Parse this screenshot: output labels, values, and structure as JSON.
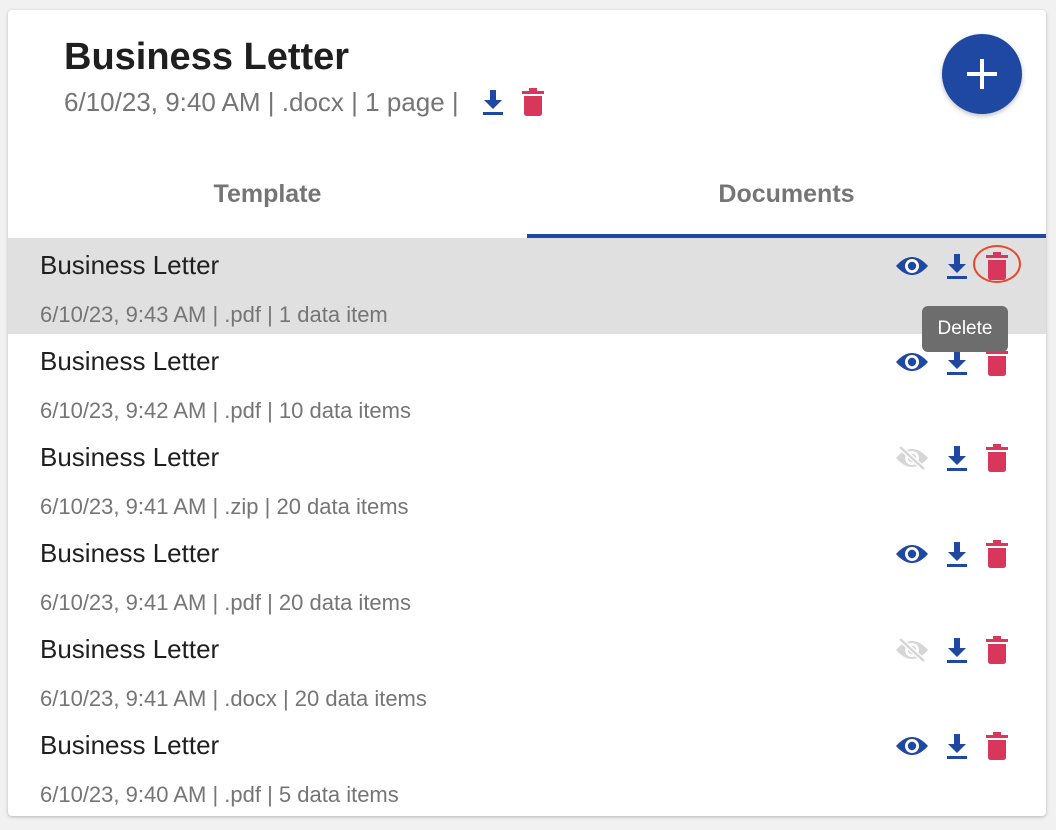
{
  "header": {
    "title": "Business Letter",
    "meta": "6/10/23, 9:40 AM | .docx | 1 page | ",
    "icons": {
      "download": "download-icon",
      "delete": "trash-icon",
      "add": "plus-icon"
    }
  },
  "tabs": [
    {
      "label": "Template",
      "active": false
    },
    {
      "label": "Documents",
      "active": true
    }
  ],
  "tooltip": {
    "label": "Delete"
  },
  "colors": {
    "accent": "#1f48a3",
    "delete": "#d9365c",
    "disabled": "#d6d6d6",
    "selected_row": "#e0e0e0",
    "focus_ring": "#e8472b"
  },
  "documents": [
    {
      "name": "Business Letter",
      "meta": "6/10/23, 9:43 AM | .pdf | 1 data item",
      "viewable": true,
      "selected": true
    },
    {
      "name": "Business Letter",
      "meta": "6/10/23, 9:42 AM | .pdf | 10 data items",
      "viewable": true,
      "selected": false
    },
    {
      "name": "Business Letter",
      "meta": "6/10/23, 9:41 AM | .zip | 20 data items",
      "viewable": false,
      "selected": false
    },
    {
      "name": "Business Letter",
      "meta": "6/10/23, 9:41 AM | .pdf | 20 data items",
      "viewable": true,
      "selected": false
    },
    {
      "name": "Business Letter",
      "meta": "6/10/23, 9:41 AM | .docx | 20 data items",
      "viewable": false,
      "selected": false
    },
    {
      "name": "Business Letter",
      "meta": "6/10/23, 9:40 AM | .pdf | 5 data items",
      "viewable": true,
      "selected": false
    }
  ]
}
